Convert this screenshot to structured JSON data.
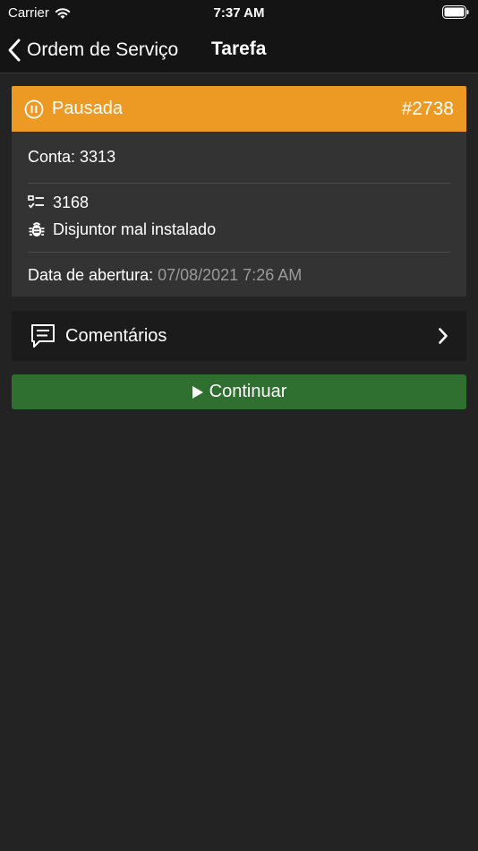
{
  "status_bar": {
    "carrier": "Carrier",
    "time": "7:37 AM"
  },
  "nav": {
    "back_label": "Ordem de Serviço",
    "title": "Tarefa"
  },
  "task": {
    "status": "Pausada",
    "number": "#2738",
    "status_color": "#ec9a23",
    "account": "Conta: 3313",
    "checklist_code": "3168",
    "problem": "Disjuntor mal instalado",
    "date_label": "Data de abertura:",
    "date_value": "07/08/2021 7:26 AM"
  },
  "comments": {
    "label": "Comentários"
  },
  "actions": {
    "continue_label": "Continuar",
    "continue_color": "#2f6f2f"
  }
}
